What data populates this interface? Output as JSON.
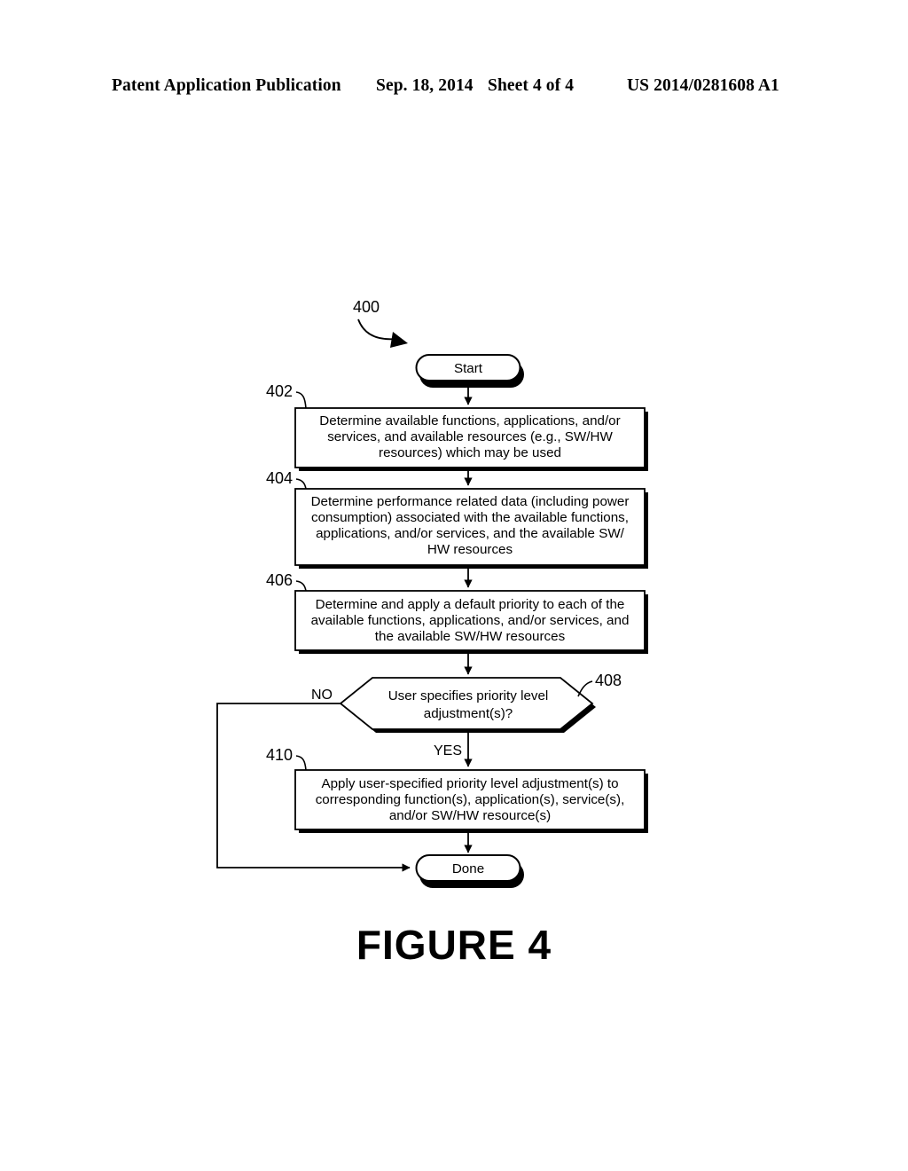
{
  "header": {
    "publication_type": "Patent Application Publication",
    "date": "Sep. 18, 2014",
    "sheet": "Sheet 4 of 4",
    "publication_number": "US 2014/0281608 A1"
  },
  "figure": {
    "caption": "FIGURE 4",
    "diagram_reference": "400"
  },
  "flowchart": {
    "start_label": "Start",
    "done_label": "Done",
    "branch_no": "NO",
    "branch_yes": "YES",
    "steps": [
      {
        "ref": "402",
        "type": "process",
        "lines": [
          "Determine available functions, applications, and/or",
          "services, and available resources (e.g., SW/HW",
          "resources) which may be used"
        ]
      },
      {
        "ref": "404",
        "type": "process",
        "lines": [
          "Determine performance related data (including power",
          "consumption) associated with the available functions,",
          "applications, and/or services, and the available SW/",
          "HW resources"
        ]
      },
      {
        "ref": "406",
        "type": "process",
        "lines": [
          "Determine and apply a default priority to each of the",
          "available functions, applications, and/or services, and",
          "the available SW/HW resources"
        ]
      },
      {
        "ref": "408",
        "type": "decision",
        "lines": [
          "User specifies priority level",
          "adjustment(s)?"
        ]
      },
      {
        "ref": "410",
        "type": "process",
        "lines": [
          "Apply user-specified priority level adjustment(s) to",
          "corresponding function(s), application(s), service(s),",
          "and/or SW/HW resource(s)"
        ]
      }
    ]
  },
  "colors": {
    "ink": "#000000",
    "paper": "#ffffff"
  }
}
